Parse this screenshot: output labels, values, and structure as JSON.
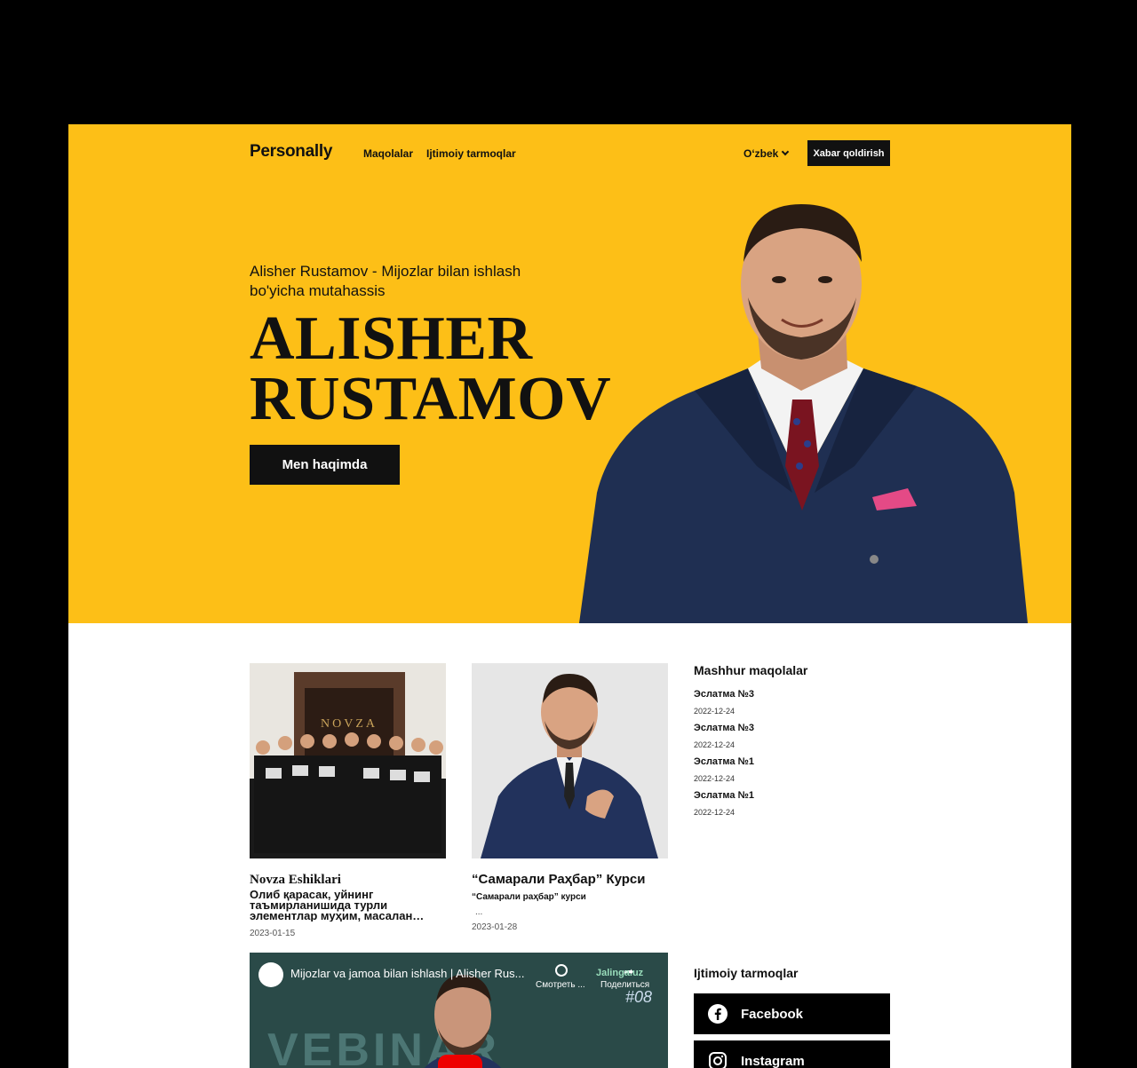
{
  "header": {
    "logo": "Personally",
    "nav": [
      "Maqolalar",
      "Ijtimoiy tarmoqlar"
    ],
    "language": "O‘zbek",
    "cta": "Xabar qoldirish"
  },
  "hero": {
    "subtitle": "Alisher Rustamov - Mijozlar bilan ishlash bo'yicha mutahassis",
    "name_line1": "ALISHER",
    "name_line2": "RUSTAMOV",
    "button": "Men haqimda"
  },
  "articles": [
    {
      "title": "Novza Eshiklari",
      "description": "Олиб қарасак, уйнинг таъмирланишида турли элементлар муҳим, масалан…",
      "date": "2023-01-15",
      "image_text": "NOVZA"
    },
    {
      "title": "“Самарали Раҳбар” Курси",
      "description": "“Самарали раҳбар” курси",
      "dots": "...",
      "date": "2023-01-28"
    }
  ],
  "popular": {
    "heading": "Mashhur maqolalar",
    "items": [
      {
        "title": "Эслатма №3",
        "date": "2022-12-24"
      },
      {
        "title": "Эслатма №3",
        "date": "2022-12-24"
      },
      {
        "title": "Эслатма №1",
        "date": "2022-12-24"
      },
      {
        "title": "Эслатма №1",
        "date": "2022-12-24"
      }
    ]
  },
  "video": {
    "title": "Mijozlar va jamoa bilan ishlash | Alisher Rus...",
    "watch_later": "Смотреть ...",
    "share": "Поделиться",
    "watermark": "Jalinga.uz",
    "episode": "#08",
    "bg_text": "VEBINAR"
  },
  "social": {
    "heading": "Ijtimoiy tarmoqlar",
    "links": [
      {
        "label": "Facebook",
        "icon": "facebook-icon"
      },
      {
        "label": "Instagram",
        "icon": "instagram-icon"
      }
    ]
  },
  "colors": {
    "hero_bg": "#fdbf17",
    "dark": "#111111",
    "suit": "#1f2f52"
  }
}
